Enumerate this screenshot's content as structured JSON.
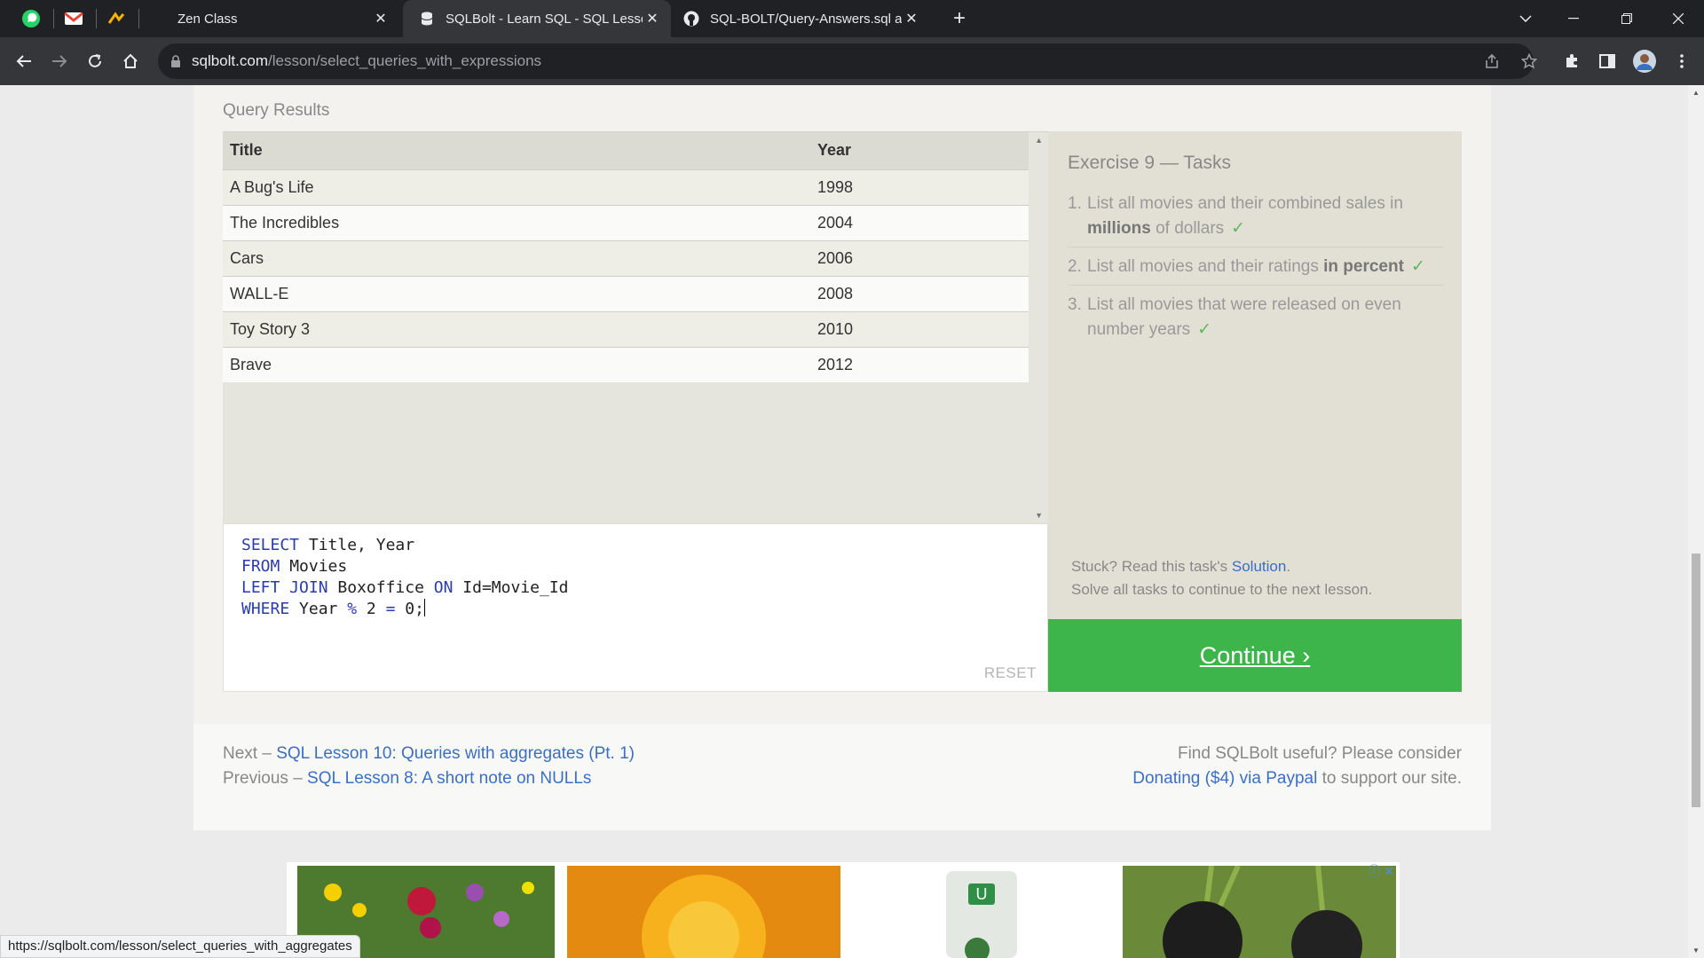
{
  "browser": {
    "tabs": [
      {
        "title": "Zen Class",
        "active": false
      },
      {
        "title": "SQLBolt - Learn SQL - SQL Lesson",
        "active": true
      },
      {
        "title": "SQL-BOLT/Query-Answers.sql at",
        "active": false
      }
    ],
    "url_host": "sqlbolt.com",
    "url_path": "/lesson/select_queries_with_expressions",
    "status_url": "https://sqlbolt.com/lesson/select_queries_with_aggregates"
  },
  "page": {
    "query_results_label": "Query Results",
    "results": {
      "columns": [
        "Title",
        "Year"
      ],
      "rows": [
        [
          "A Bug's Life",
          "1998"
        ],
        [
          "The Incredibles",
          "2004"
        ],
        [
          "Cars",
          "2006"
        ],
        [
          "WALL-E",
          "2008"
        ],
        [
          "Toy Story 3",
          "2010"
        ],
        [
          "Brave",
          "2012"
        ]
      ]
    },
    "editor": {
      "lines": [
        [
          {
            "kw": "SELECT"
          },
          {
            "t": " Title, Year"
          }
        ],
        [
          {
            "kw": "FROM"
          },
          {
            "t": " Movies"
          }
        ],
        [
          {
            "kw": "LEFT JOIN"
          },
          {
            "t": " Boxoffice "
          },
          {
            "kw": "ON"
          },
          {
            "t": " Id=Movie_Id"
          }
        ],
        [
          {
            "kw": "WHERE"
          },
          {
            "t": " Year "
          },
          {
            "kw": "%"
          },
          {
            "t": " 2 "
          },
          {
            "kw": "="
          },
          {
            "t": " 0;"
          }
        ]
      ],
      "reset_label": "RESET"
    },
    "tasks": {
      "title": "Exercise 9 — Tasks",
      "items": [
        {
          "num": "1.",
          "pre": "List all movies and their combined sales in ",
          "bold": "millions",
          "post": " of dollars",
          "check": "✓"
        },
        {
          "num": "2.",
          "pre": "List all movies and their ratings ",
          "bold": "in percent",
          "post": "",
          "check": "✓"
        },
        {
          "num": "3.",
          "pre": "List all movies that were released on even number years",
          "bold": "",
          "post": "",
          "check": "✓"
        }
      ],
      "stuck_prefix": "Stuck? Read this task's ",
      "solution_link": "Solution",
      "stuck_suffix": ".",
      "solve_all": "Solve all tasks to continue to the next lesson."
    },
    "continue_label": "Continue ›",
    "nav": {
      "next_prefix": "Next – ",
      "next_link": "SQL Lesson 10: Queries with aggregates (Pt. 1)",
      "prev_prefix": "Previous – ",
      "prev_link": "SQL Lesson 8: A short note on NULLs",
      "donate_line1": "Find SQLBolt useful? Please consider",
      "donate_link": "Donating ($4) via Paypal",
      "donate_suffix": " to support our site."
    }
  },
  "colors": {
    "continue_green": "#3db54a",
    "link_blue": "#3a6fc4",
    "sql_keyword": "#2a3cb0"
  }
}
